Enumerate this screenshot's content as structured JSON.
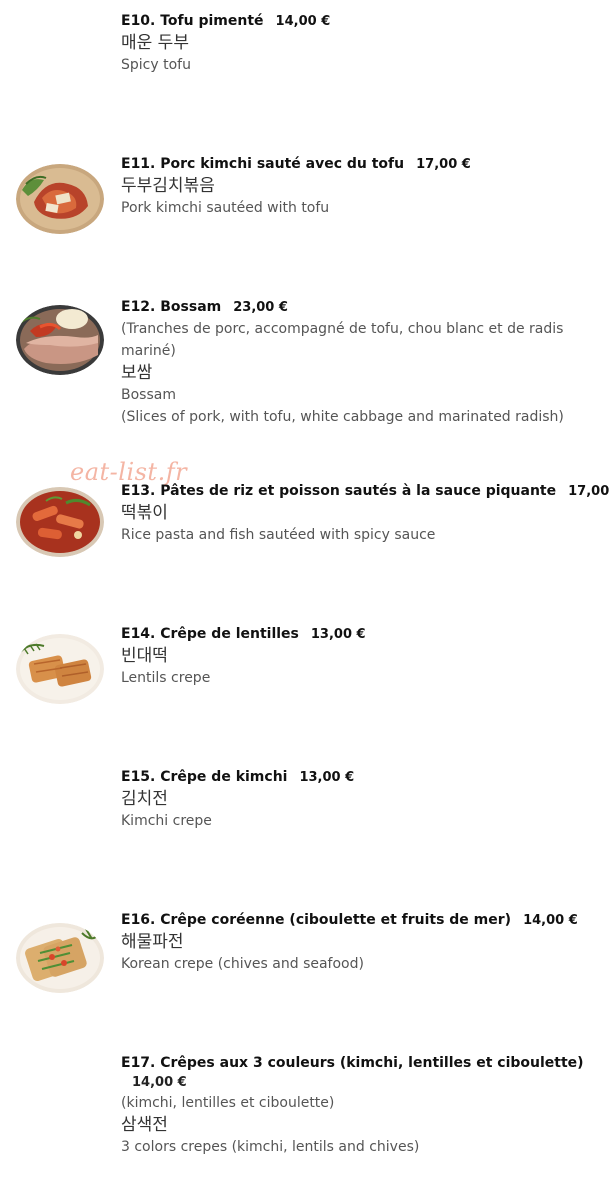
{
  "watermark": "eat-list.fr",
  "items": [
    {
      "title": "E10. Tofu pimenté",
      "price": "14,00 €",
      "korean": "매운 두부",
      "english": "Spicy tofu"
    },
    {
      "title": "E11. Porc kimchi sauté avec du tofu",
      "price": "17,00 €",
      "korean": "두부김치볶음",
      "english": "Pork kimchi sautéed with tofu"
    },
    {
      "title": "E12. Bossam",
      "price": "23,00 €",
      "french_desc": "(Tranches de porc, accompagné de tofu, chou blanc et de radis mariné)",
      "korean": "보쌈",
      "english": "Bossam",
      "english_desc": "(Slices of pork, with tofu, white cabbage and marinated radish)"
    },
    {
      "title": "E13. Pâtes de riz et poisson sautés à la sauce piquante",
      "price": "17,00 €",
      "korean": "떡볶이",
      "english": "Rice pasta and fish sautéed with spicy sauce"
    },
    {
      "title": "E14. Crêpe de lentilles",
      "price": "13,00 €",
      "korean": "빈대떡",
      "english": "Lentils crepe"
    },
    {
      "title": "E15. Crêpe de kimchi",
      "price": "13,00 €",
      "korean": "김치전",
      "english": "Kimchi crepe"
    },
    {
      "title": "E16. Crêpe coréenne (ciboulette et fruits de mer)",
      "price": "14,00 €",
      "korean": "해물파전",
      "english": "Korean crepe (chives and seafood)"
    },
    {
      "title": "E17. Crêpes aux 3 couleurs (kimchi, lentilles et ciboulette)",
      "price": "14,00 €",
      "french_desc": "(kimchi, lentilles et ciboulette)",
      "korean": "삼색전",
      "english": "3 colors crepes (kimchi, lentils and chives)"
    }
  ]
}
